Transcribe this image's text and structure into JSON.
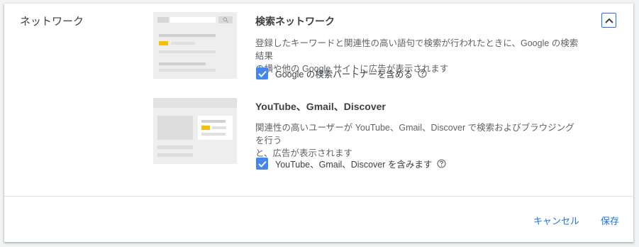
{
  "section": {
    "title": "ネットワーク"
  },
  "search_network": {
    "title": "検索ネットワーク",
    "description_line1": "登録したキーワードと関連性の高い語句で検索が行われたときに、Google の検索結果",
    "description_line2": "の横や他の Google サイトに広告が表示されます",
    "checkbox_label": "Google の検索パートナーを含める",
    "checked": true
  },
  "display_network": {
    "title": "YouTube、Gmail、Discover",
    "description_line1": "関連性の高いユーザーが YouTube、Gmail、Discover で検索およびブラウジングを行う",
    "description_line2": "と、広告が表示されます",
    "checkbox_label": "YouTube、Gmail、Discover を含みます",
    "checked": true
  },
  "footer": {
    "cancel_label": "キャンセル",
    "save_label": "保存"
  },
  "colors": {
    "accent": "#1a73e8",
    "checkbox": "#4285f4",
    "ad_highlight": "#fbbc04"
  },
  "icons": {
    "collapse": "chevron-up-icon",
    "help": "help-circle-icon",
    "check": "check-icon",
    "search": "search-icon"
  }
}
